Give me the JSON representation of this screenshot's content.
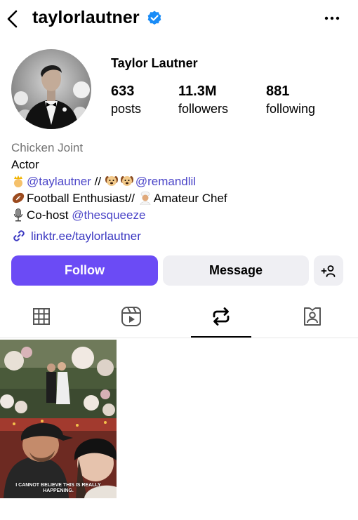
{
  "header": {
    "username": "taylorlautner",
    "verified": true
  },
  "profile": {
    "display_name": "Taylor Lautner",
    "stats": [
      {
        "value": "633",
        "label": "posts"
      },
      {
        "value": "11.3M",
        "label": "followers"
      },
      {
        "value": "881",
        "label": "following"
      }
    ],
    "category": "Chicken Joint",
    "bio": {
      "line1": "Actor",
      "line2_mention1": "@taylautner",
      "line2_sep": " // ",
      "line2_mention2": "@remandlil",
      "line3_text": "Football Enthusiast//",
      "line3_text2": "Amateur Chef",
      "line4_prefix": "Co-host ",
      "line4_mention": "@thesqueeze"
    },
    "link": "linktr.ee/taylorlautner"
  },
  "actions": {
    "follow_label": "Follow",
    "message_label": "Message"
  },
  "tabs": [
    {
      "name": "posts",
      "icon": "grid-icon",
      "active": false
    },
    {
      "name": "reels",
      "icon": "reels-icon",
      "active": false
    },
    {
      "name": "reposts",
      "icon": "repost-icon",
      "active": true
    },
    {
      "name": "tagged",
      "icon": "tagged-icon",
      "active": false
    }
  ],
  "posts": [
    {
      "caption": "I CANNOT BELIEVE THIS IS REALLY HAPPENING."
    }
  ],
  "colors": {
    "accent": "#6b4bf5",
    "link": "#3a37c1",
    "verified": "#1a8cf7",
    "button_gray": "#efeff3"
  }
}
